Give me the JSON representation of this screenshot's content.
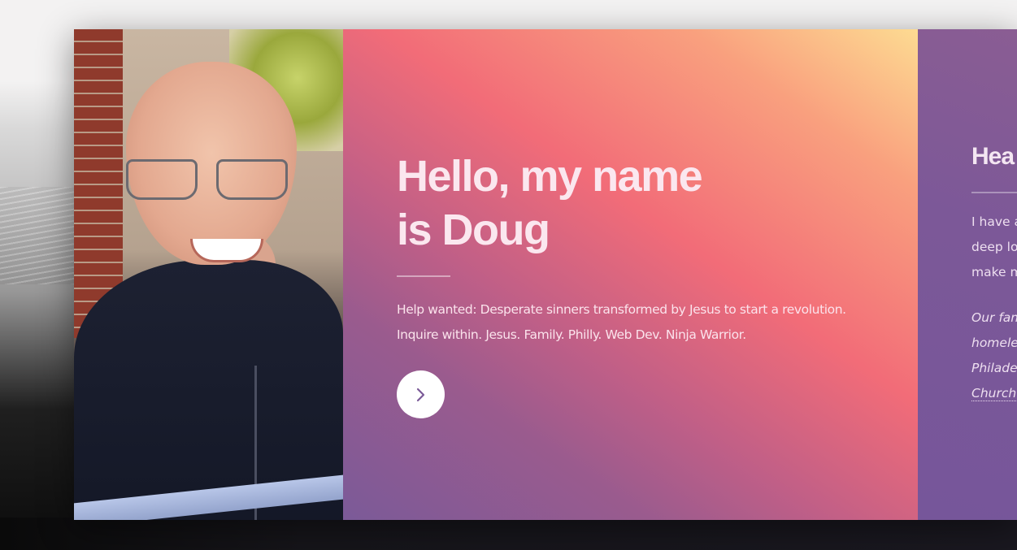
{
  "hero": {
    "title": "Hello, my name is Doug",
    "title_line1": "Hello, my name",
    "title_line2": "is Doug",
    "tagline_line1": "Help wanted: Desperate sinners transformed by Jesus to start a revolution.",
    "tagline_line2": "Inquire within. Jesus. Family. Philly. Web Dev. Ninja Warrior.",
    "next_button_icon": "chevron-right-icon"
  },
  "panel2": {
    "title": "Hea",
    "text_lines": [
      "I have a",
      "deep lo",
      "make m"
    ],
    "italic_lines": [
      "Our fam",
      "homele",
      "Philade",
      "Church"
    ]
  },
  "colors": {
    "hero_gradient": [
      "#fddb92",
      "#f26c78",
      "#7b5a98"
    ],
    "panel_purple": "#7c5898",
    "button_bg": "#ffffff",
    "chevron": "#7b5a98"
  }
}
